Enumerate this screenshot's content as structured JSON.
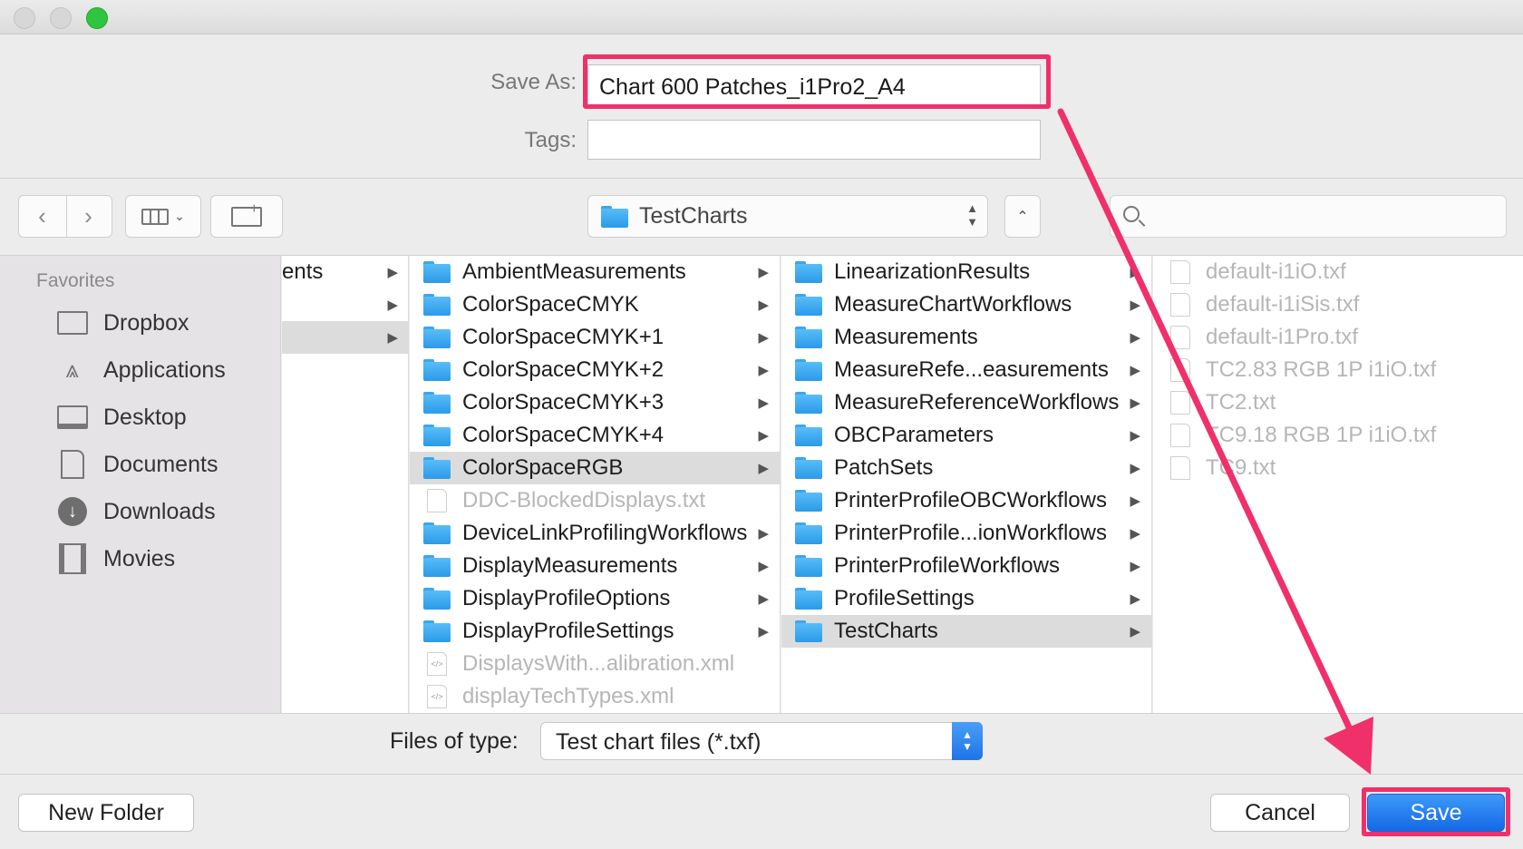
{
  "dialog": {
    "save_as_label": "Save As:",
    "save_as_value": "Chart 600 Patches_i1Pro2_A4",
    "tags_label": "Tags:",
    "tags_value": ""
  },
  "toolbar": {
    "back_icon": "chevron-left-icon",
    "forward_icon": "chevron-right-icon",
    "view_icon": "column-view-icon",
    "new_folder_icon": "new-folder-icon",
    "location": "TestCharts",
    "search_placeholder": ""
  },
  "sidebar": {
    "title": "Favorites",
    "items": [
      {
        "label": "Dropbox",
        "icon": "folder-icon"
      },
      {
        "label": "Applications",
        "icon": "applications-icon"
      },
      {
        "label": "Desktop",
        "icon": "desktop-icon"
      },
      {
        "label": "Documents",
        "icon": "documents-icon"
      },
      {
        "label": "Downloads",
        "icon": "downloads-icon"
      },
      {
        "label": "Movies",
        "icon": "movies-icon"
      }
    ]
  },
  "columns": {
    "col0": [
      "ents",
      "",
      ""
    ],
    "col1": [
      {
        "label": "AmbientMeasurements",
        "type": "folder"
      },
      {
        "label": "ColorSpaceCMYK",
        "type": "folder"
      },
      {
        "label": "ColorSpaceCMYK+1",
        "type": "folder"
      },
      {
        "label": "ColorSpaceCMYK+2",
        "type": "folder"
      },
      {
        "label": "ColorSpaceCMYK+3",
        "type": "folder"
      },
      {
        "label": "ColorSpaceCMYK+4",
        "type": "folder"
      },
      {
        "label": "ColorSpaceRGB",
        "type": "folder",
        "selected": true
      },
      {
        "label": "DDC-BlockedDisplays.txt",
        "type": "file"
      },
      {
        "label": "DeviceLinkProfilingWorkflows",
        "type": "folder"
      },
      {
        "label": "DisplayMeasurements",
        "type": "folder"
      },
      {
        "label": "DisplayProfileOptions",
        "type": "folder"
      },
      {
        "label": "DisplayProfileSettings",
        "type": "folder"
      },
      {
        "label": "DisplaysWith...alibration.xml",
        "type": "xml"
      },
      {
        "label": "displayTechTypes.xml",
        "type": "xml"
      }
    ],
    "col2": [
      {
        "label": "LinearizationResults",
        "type": "folder"
      },
      {
        "label": "MeasureChartWorkflows",
        "type": "folder"
      },
      {
        "label": "Measurements",
        "type": "folder"
      },
      {
        "label": "MeasureRefe...easurements",
        "type": "folder"
      },
      {
        "label": "MeasureReferenceWorkflows",
        "type": "folder"
      },
      {
        "label": "OBCParameters",
        "type": "folder"
      },
      {
        "label": "PatchSets",
        "type": "folder"
      },
      {
        "label": "PrinterProfileOBCWorkflows",
        "type": "folder"
      },
      {
        "label": "PrinterProfile...ionWorkflows",
        "type": "folder"
      },
      {
        "label": "PrinterProfileWorkflows",
        "type": "folder"
      },
      {
        "label": "ProfileSettings",
        "type": "folder"
      },
      {
        "label": "TestCharts",
        "type": "folder",
        "selected": true
      }
    ],
    "col3": [
      {
        "label": "default-i1iO.txf",
        "type": "file"
      },
      {
        "label": "default-i1iSis.txf",
        "type": "file"
      },
      {
        "label": "default-i1Pro.txf",
        "type": "file"
      },
      {
        "label": "TC2.83 RGB 1P i1iO.txf",
        "type": "file"
      },
      {
        "label": "TC2.txt",
        "type": "file"
      },
      {
        "label": "TC9.18 RGB 1P i1iO.txf",
        "type": "file"
      },
      {
        "label": "TC9.txt",
        "type": "file"
      }
    ]
  },
  "filetype": {
    "label": "Files of type:",
    "value": "Test chart files (*.txf)"
  },
  "buttons": {
    "new_folder": "New Folder",
    "cancel": "Cancel",
    "save": "Save"
  },
  "colors": {
    "highlight": "#f0306a",
    "accent": "#1f74e8"
  }
}
